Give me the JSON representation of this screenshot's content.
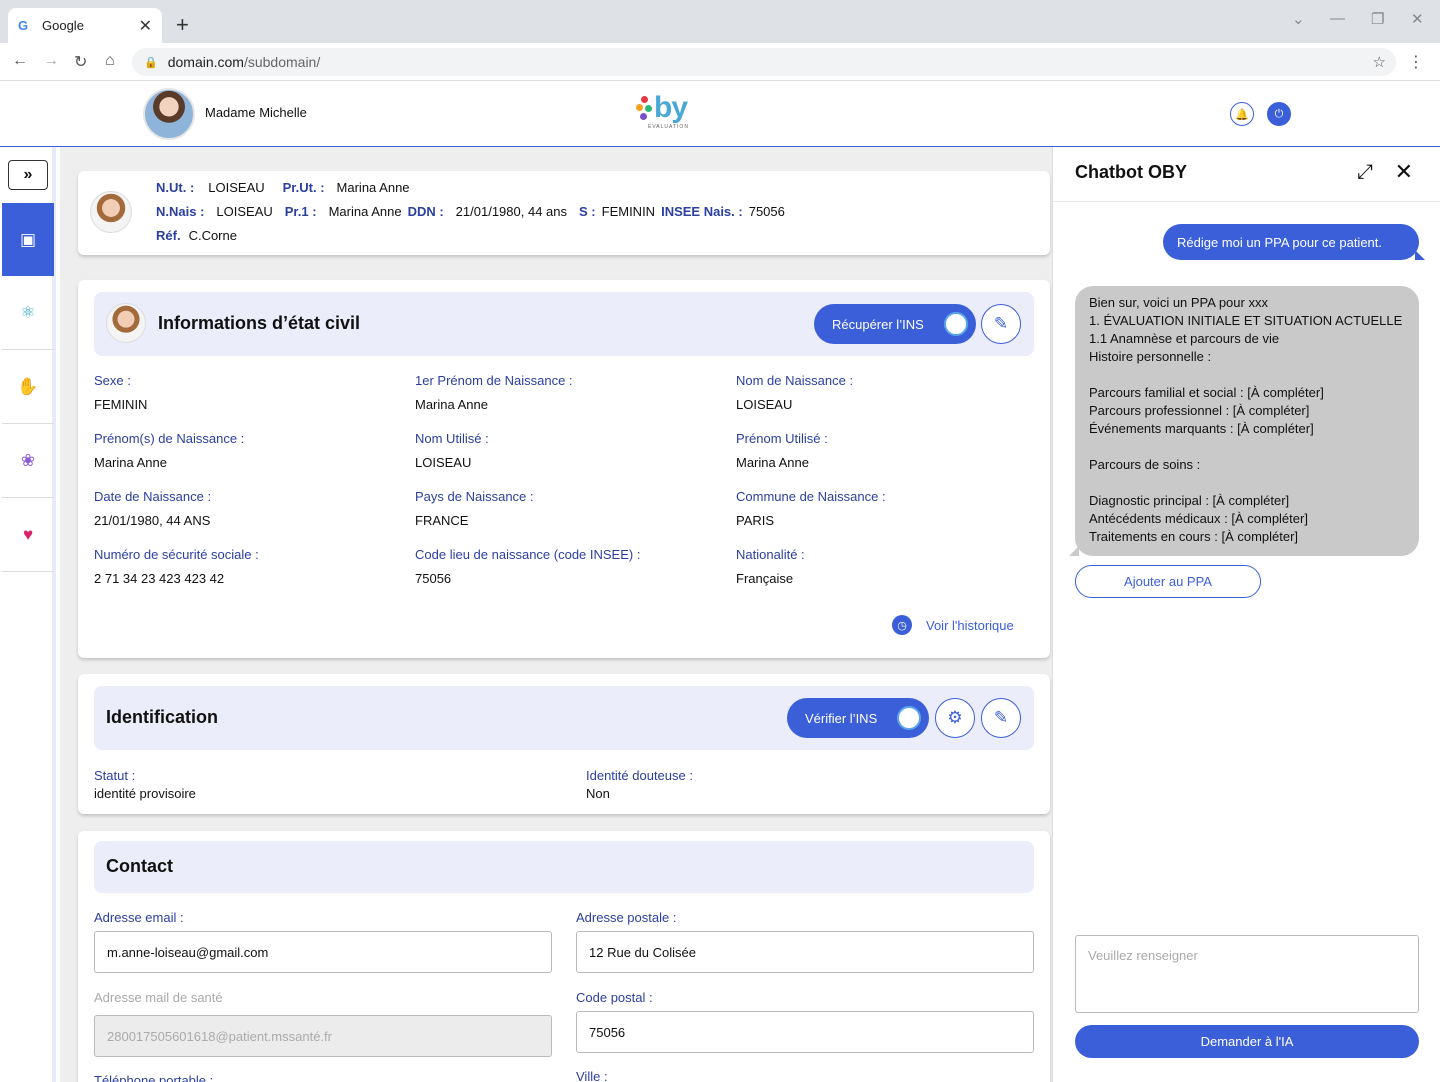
{
  "browser": {
    "tab_title": "Google",
    "url_domain": "domain.com",
    "url_path": "/subdomain/"
  },
  "header": {
    "username": "Madame Michelle",
    "logo_text": "by",
    "logo_sub": "EVALUATION"
  },
  "patient": {
    "nut_label": "N.Ut. :",
    "nut_value": "LOISEAU",
    "prut_label": "Pr.Ut. :",
    "prut_value": "Marina Anne",
    "nnais_label": "N.Nais :",
    "nnais_value": "LOISEAU",
    "pr1_label": "Pr.1 :",
    "pr1_value": "Marina Anne",
    "ddn_label": "DDN :",
    "ddn_value": "21/01/1980, 44 ans",
    "s_label": "S :",
    "s_value": "FEMININ",
    "insee_label": "INSEE Nais. :",
    "insee_value": "75056",
    "ref_label": "Réf.",
    "ref_value": "C.Corne"
  },
  "civil": {
    "title": "Informations d’état civil",
    "recover_btn": "Récupérer l’INS",
    "history": "Voir l'historique",
    "fields": [
      {
        "label": "Sexe :",
        "value": "FEMININ"
      },
      {
        "label": "1er Prénom de Naissance :",
        "value": "Marina Anne"
      },
      {
        "label": "Nom de Naissance :",
        "value": "LOISEAU"
      },
      {
        "label": "Prénom(s) de Naissance :",
        "value": "Marina Anne"
      },
      {
        "label": "Nom Utilisé :",
        "value": "LOISEAU"
      },
      {
        "label": "Prénom Utilisé :",
        "value": "Marina Anne"
      },
      {
        "label": "Date de Naissance :",
        "value": "21/01/1980, 44 ANS"
      },
      {
        "label": "Pays de Naissance :",
        "value": "FRANCE"
      },
      {
        "label": "Commune de Naissance :",
        "value": "PARIS"
      },
      {
        "label": "Numéro de sécurité sociale :",
        "value": "2 71 34 23 423 423 42"
      },
      {
        "label": "Code lieu de naissance (code INSEE) :",
        "value": "75056"
      },
      {
        "label": "Nationalité :",
        "value": "Française"
      }
    ]
  },
  "identification": {
    "title": "Identification",
    "verify_btn": "Vérifier l’INS",
    "status_label": "Statut :",
    "status_value": "identité provisoire",
    "doubt_label": "Identité douteuse :",
    "doubt_value": "Non"
  },
  "contact": {
    "title": "Contact",
    "email_label": "Adresse email :",
    "email_value": "m.anne-loiseau@gmail.com",
    "postal_label": "Adresse postale :",
    "postal_value": "12 Rue du Colisée",
    "health_mail_label": "Adresse mail de santé",
    "health_mail_value": "280017505601618@patient.mssanté.fr",
    "zip_label": "Code postal :",
    "zip_value": "75056",
    "phone_label": "Téléphone portable :",
    "city_label": "Ville :"
  },
  "chat": {
    "title": "Chatbot OBY",
    "user_msg": "Rédige moi un PPA pour ce patient.",
    "bot_msg": "Bien sur, voici un PPA pour xxx\n1. ÉVALUATION INITIALE ET SITUATION ACTUELLE\n1.1 Anamnèse et parcours de vie\nHistoire personnelle :\n\nParcours familial et social : [À compléter]\nParcours professionnel : [À compléter]\nÉvénements marquants : [À compléter]\n\nParcours de soins :\n\nDiagnostic principal : [À compléter]\nAntécédents médicaux : [À compléter]\nTraitements en cours : [À compléter]",
    "add_btn": "Ajouter au PPA",
    "input_placeholder": "Veuillez renseigner",
    "ask_btn": "Demander à l'IA"
  },
  "colors": {
    "accent": "#3a5fd9",
    "label": "#2b3fa0",
    "section_bg": "#ebedfa"
  }
}
